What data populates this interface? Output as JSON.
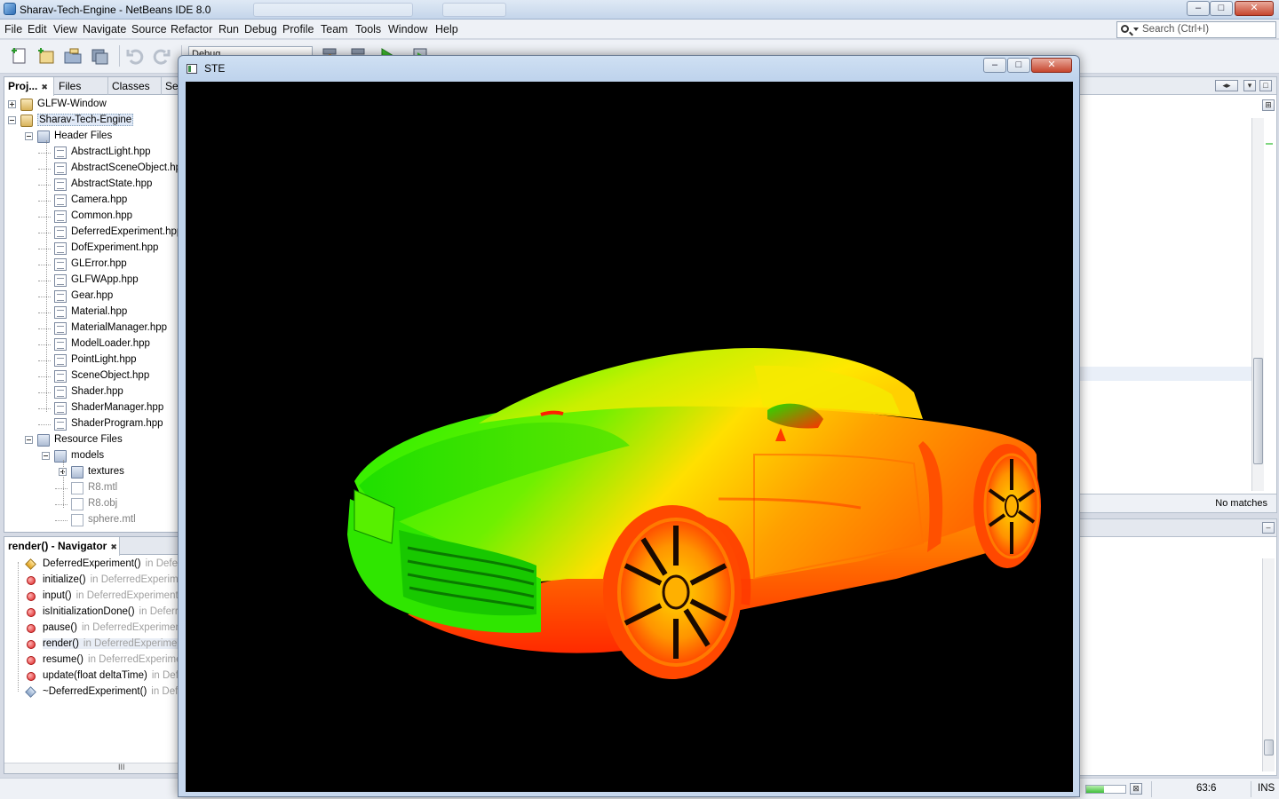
{
  "window": {
    "title": "Sharav-Tech-Engine - NetBeans IDE 8.0",
    "minimize": "–",
    "maximize": "□",
    "close": "✕"
  },
  "menu": [
    "File",
    "Edit",
    "View",
    "Navigate",
    "Source",
    "Refactor",
    "Run",
    "Debug",
    "Profile",
    "Team",
    "Tools",
    "Window",
    "Help"
  ],
  "search": {
    "placeholder": "Search (Ctrl+I)"
  },
  "toolbar": {
    "configuration": "Debug"
  },
  "projects_panel": {
    "tabs": [
      {
        "label": "Proj...",
        "active": true
      },
      {
        "label": "Files"
      },
      {
        "label": "Classes"
      },
      {
        "label": "Se"
      }
    ],
    "tree": [
      {
        "label": "GLFW-Window",
        "level": 0,
        "icon": "project-icon",
        "expander": "plus"
      },
      {
        "label": "Sharav-Tech-Engine",
        "level": 0,
        "icon": "project-icon",
        "expander": "minus",
        "selected": true
      },
      {
        "label": "Header Files",
        "level": 1,
        "icon": "folder-icon",
        "expander": "minus"
      },
      {
        "label": "AbstractLight.hpp",
        "level": 2,
        "icon": "header-file-icon"
      },
      {
        "label": "AbstractSceneObject.hpp",
        "level": 2,
        "icon": "header-file-icon"
      },
      {
        "label": "AbstractState.hpp",
        "level": 2,
        "icon": "header-file-icon"
      },
      {
        "label": "Camera.hpp",
        "level": 2,
        "icon": "header-file-icon"
      },
      {
        "label": "Common.hpp",
        "level": 2,
        "icon": "header-file-icon"
      },
      {
        "label": "DeferredExperiment.hpp",
        "level": 2,
        "icon": "header-file-icon"
      },
      {
        "label": "DofExperiment.hpp",
        "level": 2,
        "icon": "header-file-icon"
      },
      {
        "label": "GLError.hpp",
        "level": 2,
        "icon": "header-file-icon"
      },
      {
        "label": "GLFWApp.hpp",
        "level": 2,
        "icon": "header-file-icon"
      },
      {
        "label": "Gear.hpp",
        "level": 2,
        "icon": "header-file-icon"
      },
      {
        "label": "Material.hpp",
        "level": 2,
        "icon": "header-file-icon"
      },
      {
        "label": "MaterialManager.hpp",
        "level": 2,
        "icon": "header-file-icon"
      },
      {
        "label": "ModelLoader.hpp",
        "level": 2,
        "icon": "header-file-icon"
      },
      {
        "label": "PointLight.hpp",
        "level": 2,
        "icon": "header-file-icon"
      },
      {
        "label": "SceneObject.hpp",
        "level": 2,
        "icon": "header-file-icon"
      },
      {
        "label": "Shader.hpp",
        "level": 2,
        "icon": "header-file-icon"
      },
      {
        "label": "ShaderManager.hpp",
        "level": 2,
        "icon": "header-file-icon"
      },
      {
        "label": "ShaderProgram.hpp",
        "level": 2,
        "icon": "header-file-icon"
      },
      {
        "label": "Resource Files",
        "level": 1,
        "icon": "folder-icon",
        "expander": "minus"
      },
      {
        "label": "models",
        "level": 2,
        "icon": "folder-icon",
        "expander": "minus"
      },
      {
        "label": "textures",
        "level": 3,
        "icon": "folder-icon",
        "expander": "plus"
      },
      {
        "label": "R8.mtl",
        "level": 3,
        "icon": "resource-file-icon",
        "dim": true
      },
      {
        "label": "R8.obj",
        "level": 3,
        "icon": "resource-file-icon",
        "dim": true
      },
      {
        "label": "sphere.mtl",
        "level": 3,
        "icon": "resource-file-icon",
        "dim": true
      }
    ]
  },
  "navigator": {
    "title": "render() - Navigator",
    "items": [
      {
        "name": "DeferredExperiment()",
        "owner": "in DeferredExperiment",
        "icon": "constructor-icon"
      },
      {
        "name": "initialize()",
        "owner": "in DeferredExperiment",
        "icon": "method-icon"
      },
      {
        "name": "input()",
        "owner": "in DeferredExperiment",
        "icon": "method-icon"
      },
      {
        "name": "isInitializationDone()",
        "owner": "in DeferredExperiment",
        "icon": "method-icon"
      },
      {
        "name": "pause()",
        "owner": "in DeferredExperiment",
        "icon": "method-icon"
      },
      {
        "name": "render()",
        "owner": "in DeferredExperiment",
        "icon": "method-icon",
        "selected": true
      },
      {
        "name": "resume()",
        "owner": "in DeferredExperiment",
        "icon": "method-icon"
      },
      {
        "name": "update(float deltaTime)",
        "owner": "in DeferredExperiment",
        "icon": "method-icon"
      },
      {
        "name": "~DeferredExperiment()",
        "owner": "in DeferredExperiment",
        "icon": "destructor-icon"
      }
    ],
    "scroll_grip": "III"
  },
  "editor": {
    "find_status": "No matches"
  },
  "statusbar": {
    "position": "63:6",
    "mode": "INS",
    "progress": 0.45
  },
  "ste_window": {
    "title": "STE"
  },
  "colors": {
    "accent": "#3fbf3a",
    "viewport_bg": "#000000",
    "car_green": "#22f000",
    "car_red": "#ff2a00"
  }
}
